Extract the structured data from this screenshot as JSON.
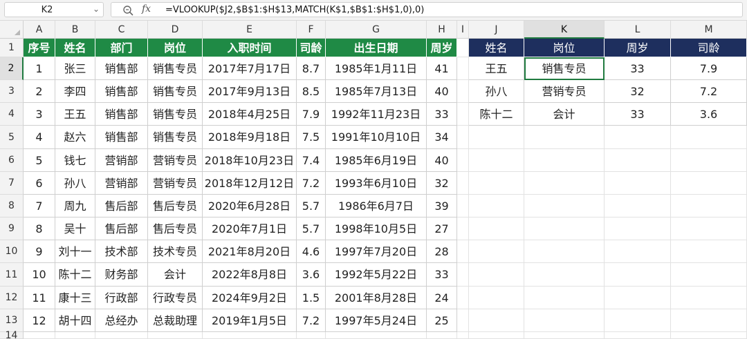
{
  "formula_bar": {
    "name_box": "K2",
    "zoom_icon": "zoom-icon",
    "fx_label": "fx",
    "formula": "=VLOOKUP($J2,$B$1:$H$13,MATCH(K$1,$B$1:$H$1,0),0)"
  },
  "grid": {
    "columns": [
      "A",
      "B",
      "C",
      "D",
      "E",
      "F",
      "G",
      "H",
      "I",
      "J",
      "K",
      "L",
      "M"
    ],
    "rows": [
      "1",
      "2",
      "3",
      "4",
      "5",
      "6",
      "7",
      "8",
      "9",
      "10",
      "11",
      "12",
      "13",
      "14"
    ],
    "active_cell": "K2"
  },
  "left_table": {
    "headers": [
      "序号",
      "姓名",
      "部门",
      "岗位",
      "入职时间",
      "司龄",
      "出生日期",
      "周岁"
    ],
    "rows": [
      [
        "1",
        "张三",
        "销售部",
        "销售专员",
        "2017年7月17日",
        "8.7",
        "1985年1月11日",
        "41"
      ],
      [
        "2",
        "李四",
        "销售部",
        "销售专员",
        "2017年9月13日",
        "8.5",
        "1985年7月13日",
        "40"
      ],
      [
        "3",
        "王五",
        "销售部",
        "销售专员",
        "2018年4月25日",
        "7.9",
        "1992年11月23日",
        "33"
      ],
      [
        "4",
        "赵六",
        "销售部",
        "销售专员",
        "2018年9月18日",
        "7.5",
        "1991年10月10日",
        "34"
      ],
      [
        "5",
        "钱七",
        "营销部",
        "营销专员",
        "2018年10月23日",
        "7.4",
        "1985年6月19日",
        "40"
      ],
      [
        "6",
        "孙八",
        "营销部",
        "营销专员",
        "2018年12月12日",
        "7.2",
        "1993年6月10日",
        "32"
      ],
      [
        "7",
        "周九",
        "售后部",
        "售后专员",
        "2020年6月28日",
        "5.7",
        "1986年6月7日",
        "39"
      ],
      [
        "8",
        "吴十",
        "售后部",
        "售后专员",
        "2020年7月1日",
        "5.7",
        "1998年10月5日",
        "27"
      ],
      [
        "9",
        "刘十一",
        "技术部",
        "技术专员",
        "2021年8月20日",
        "4.6",
        "1997年7月20日",
        "28"
      ],
      [
        "10",
        "陈十二",
        "财务部",
        "会计",
        "2022年8月8日",
        "3.6",
        "1992年5月22日",
        "33"
      ],
      [
        "11",
        "康十三",
        "行政部",
        "行政专员",
        "2024年9月2日",
        "1.5",
        "2001年8月28日",
        "24"
      ],
      [
        "12",
        "胡十四",
        "总经办",
        "总裁助理",
        "2019年1月5日",
        "7.2",
        "1997年5月24日",
        "25"
      ]
    ]
  },
  "right_table": {
    "headers": [
      "姓名",
      "岗位",
      "周岁",
      "司龄"
    ],
    "rows": [
      [
        "王五",
        "销售专员",
        "33",
        "7.9"
      ],
      [
        "孙八",
        "营销专员",
        "32",
        "7.2"
      ],
      [
        "陈十二",
        "会计",
        "33",
        "3.6"
      ]
    ]
  },
  "colors": {
    "left_header_bg": "#1f8a45",
    "right_header_bg": "#1e2f5e",
    "selection_border": "#1f7a3f"
  }
}
